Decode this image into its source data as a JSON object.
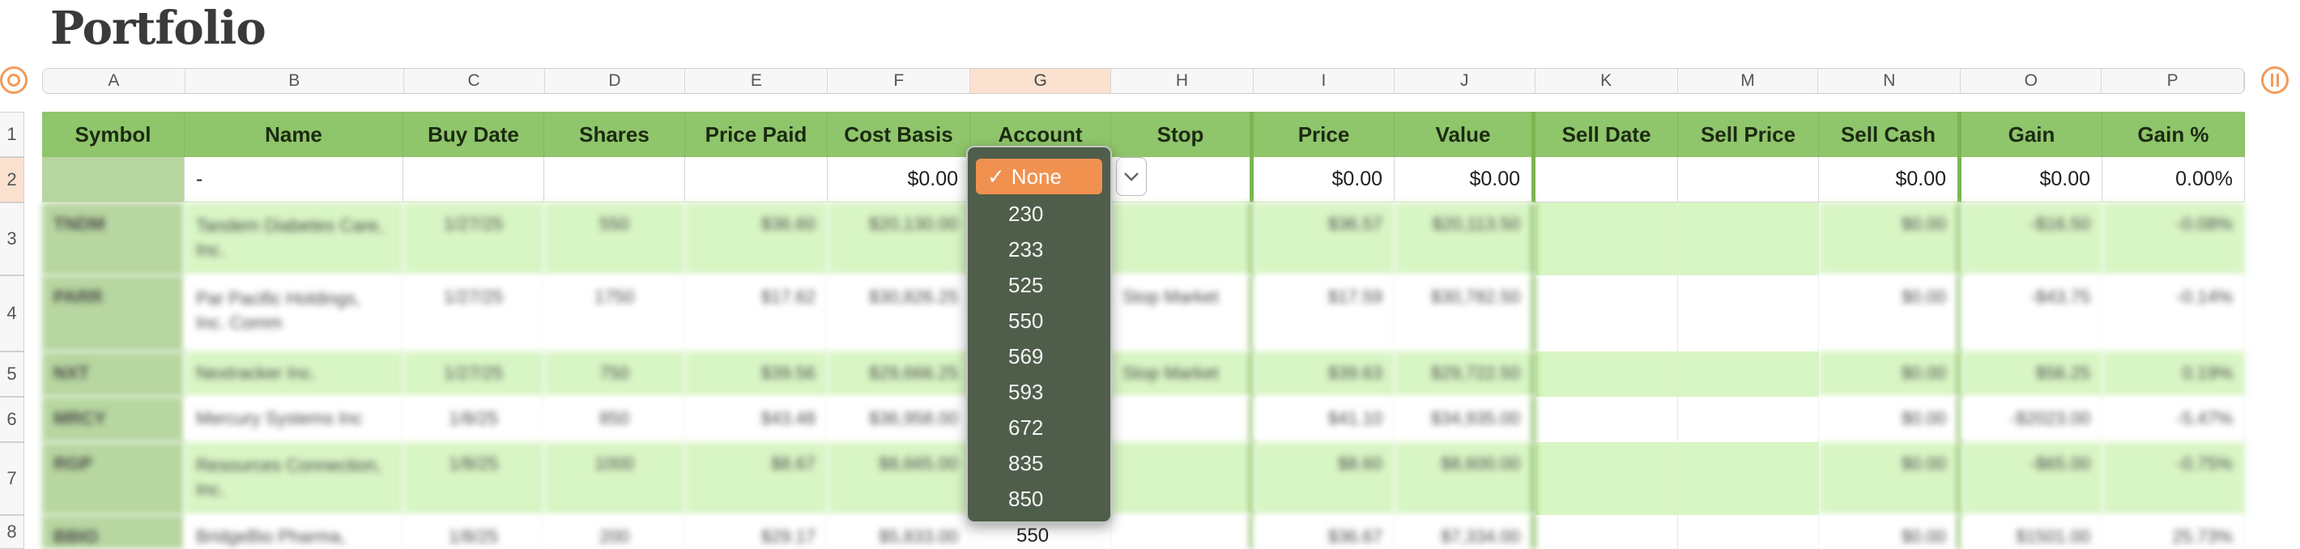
{
  "title": "Portfolio",
  "columns": [
    "A",
    "B",
    "C",
    "D",
    "E",
    "F",
    "G",
    "H",
    "I",
    "J",
    "K",
    "M",
    "N",
    "O",
    "P"
  ],
  "row_numbers": [
    "1",
    "2",
    "3",
    "4",
    "5",
    "6",
    "7",
    "8"
  ],
  "headers": [
    "Symbol",
    "Name",
    "Buy Date",
    "Shares",
    "Price Paid",
    "Cost Basis",
    "Account",
    "Stop",
    "Price",
    "Value",
    "Sell Date",
    "Sell Price",
    "Sell Cash",
    "Gain",
    "Gain %"
  ],
  "row2": {
    "name": "-",
    "cost_basis": "$0.00",
    "price": "$0.00",
    "value": "$0.00",
    "sell_cash": "$0.00",
    "gain": "$0.00",
    "gain_pct": "0.00%"
  },
  "rows": [
    {
      "symbol": "TNDM",
      "name": "Tandem Diabetes Care, Inc.",
      "buy": "1/27/25",
      "shares": "550",
      "paid": "$36.60",
      "basis": "$20,130.00",
      "stop": "",
      "price": "$36.57",
      "value": "$20,113.50",
      "sell_cash": "$0.00",
      "gain": "-$16.50",
      "gain_pct": "-0.08%"
    },
    {
      "symbol": "PARR",
      "name": "Par Pacific Holdings, Inc. Comm",
      "buy": "1/27/25",
      "shares": "1750",
      "paid": "$17.62",
      "basis": "$30,826.25",
      "stop": "Stop Market",
      "price": "$17.59",
      "value": "$30,782.50",
      "sell_cash": "$0.00",
      "gain": "-$43.75",
      "gain_pct": "-0.14%"
    },
    {
      "symbol": "NXT",
      "name": "Nextracker Inc.",
      "buy": "1/27/25",
      "shares": "750",
      "paid": "$39.56",
      "basis": "$29,666.25",
      "stop": "Stop Market",
      "price": "$39.63",
      "value": "$29,722.50",
      "sell_cash": "$0.00",
      "gain": "$56.25",
      "gain_pct": "0.19%"
    },
    {
      "symbol": "MRCY",
      "name": "Mercury Systems Inc",
      "buy": "1/8/25",
      "shares": "850",
      "paid": "$43.48",
      "basis": "$36,958.00",
      "stop": "",
      "price": "$41.10",
      "value": "$34,935.00",
      "sell_cash": "$0.00",
      "gain": "-$2023.00",
      "gain_pct": "-5.47%"
    },
    {
      "symbol": "RGP",
      "name": "Resources Connection, Inc.",
      "buy": "1/8/25",
      "shares": "1000",
      "paid": "$8.67",
      "basis": "$8,665.00",
      "stop": "",
      "price": "$8.60",
      "value": "$8,600.00",
      "sell_cash": "$0.00",
      "gain": "-$65.00",
      "gain_pct": "-0.75%"
    },
    {
      "symbol": "BBIO",
      "name": "BridgeBio Pharma,",
      "buy": "1/8/25",
      "shares": "200",
      "paid": "$29.17",
      "basis": "$5,833.00",
      "stop": "",
      "price": "$36.67",
      "value": "$7,334.00",
      "sell_cash": "$0.00",
      "gain": "$1501.00",
      "gain_pct": "25.73%"
    }
  ],
  "dropdown": {
    "options": [
      "None",
      "230",
      "233",
      "525",
      "550",
      "569",
      "593",
      "672",
      "835",
      "850"
    ],
    "selected": "None",
    "check": "✓",
    "below_value": "550"
  },
  "colors": {
    "header_green": "#8fc56b",
    "row_green": "#d8f5c4",
    "accent_orange": "#f39b5a",
    "dropdown_bg": "#4f5e4b"
  }
}
